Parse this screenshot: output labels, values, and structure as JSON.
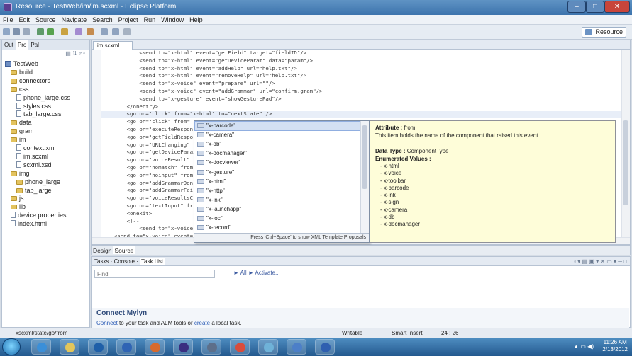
{
  "window": {
    "title": "Resource - TestWeb/im/im.scxml - Eclipse Platform",
    "min": "–",
    "max": "□",
    "close": "✕"
  },
  "menu": [
    "File",
    "Edit",
    "Source",
    "Navigate",
    "Search",
    "Project",
    "Run",
    "Window",
    "Help"
  ],
  "toolbar": {
    "perspective_label": "Resource"
  },
  "left_panel": {
    "tabs": [
      "Out",
      "Pro",
      "Pal"
    ],
    "tools": "▤ ⇅ ▿ ▫",
    "tree": [
      {
        "label": "TestWeb",
        "kind": "project",
        "depth": 0
      },
      {
        "label": "build",
        "kind": "folder",
        "depth": 1
      },
      {
        "label": "connectors",
        "kind": "folder",
        "depth": 1
      },
      {
        "label": "css",
        "kind": "folder",
        "depth": 1
      },
      {
        "label": "phone_large.css",
        "kind": "file",
        "depth": 2
      },
      {
        "label": "styles.css",
        "kind": "file",
        "depth": 2
      },
      {
        "label": "tab_large.css",
        "kind": "file",
        "depth": 2
      },
      {
        "label": "data",
        "kind": "folder",
        "depth": 1
      },
      {
        "label": "gram",
        "kind": "folder",
        "depth": 1
      },
      {
        "label": "im",
        "kind": "folder",
        "depth": 1
      },
      {
        "label": "context.xml",
        "kind": "file",
        "depth": 2
      },
      {
        "label": "im.scxml",
        "kind": "file",
        "depth": 2
      },
      {
        "label": "scxml.xsd",
        "kind": "file",
        "depth": 2
      },
      {
        "label": "img",
        "kind": "folder",
        "depth": 1
      },
      {
        "label": "phone_large",
        "kind": "folder",
        "depth": 2
      },
      {
        "label": "tab_large",
        "kind": "folder",
        "depth": 2
      },
      {
        "label": "js",
        "kind": "folder",
        "depth": 1
      },
      {
        "label": "lib",
        "kind": "folder",
        "depth": 1
      },
      {
        "label": "device.properties",
        "kind": "file",
        "depth": 1
      },
      {
        "label": "index.html",
        "kind": "file",
        "depth": 1
      }
    ]
  },
  "editor": {
    "tab_label": "im.scxml",
    "lines": [
      "            <send to=\"x-html\" event=\"getField\" target=\"fieldID\"/>",
      "            <send to=\"x-html\" event=\"getDeviceParam\" data=\"param\"/>",
      "            <send to=\"x-html\" event=\"addHelp\" url=\"help.txt\"/>",
      "            <send to=\"x-html\" event=\"removeHelp\" url=\"help.txt\"/>",
      "            <send to=\"x-voice\" event=\"prepare\" url=\"\"/>",
      "            <send to=\"x-voice\" event=\"addGrammar\" url=\"confirm.gram\"/>",
      "            <send to=\"x-gesture\" event=\"showGesturePad\"/>",
      "        </onentry>",
      "        <go on=\"click\" from=\"x-html\" to=\"nextState\" />",
      "        <go on=\"click\" from=",
      "        <go on=\"executeRespon",
      "        <go on=\"getFieldRespo",
      "        <go on=\"URLChanging\"",
      "        <go on=\"getDeviceParai",
      "        <go on=\"voiceResult\"",
      "        <go on=\"nomatch\" from",
      "        <go on=\"noinput\" from",
      "        <go on=\"addGrammarDon",
      "        <go on=\"addGrammarFai",
      "        <go on=\"voiceResultsC",
      "        <go on=\"textInput\" fr",
      "        <onexit>",
      "        <!--",
      "            <send to=\"x-voice\" ev",
      "    <send to=\"x-voice\" event="
    ]
  },
  "autocomplete": {
    "items": [
      "\"x-barcode\"",
      "\"x-camera\"",
      "\"x-db\"",
      "\"x-docmanager\"",
      "\"x-docviewer\"",
      "\"x-gesture\"",
      "\"x-html\"",
      "\"x-http\"",
      "\"x-ink\"",
      "\"x-launchapp\"",
      "\"x-loc\"",
      "\"x-record\""
    ],
    "hint": "Press 'Ctrl+Space' to show XML Template Proposals"
  },
  "doc": {
    "attribute_label": "Attribute :",
    "attribute_value": "from",
    "description": "This item holds the name of the component that raised this event.",
    "datatype_label": "Data Type :",
    "datatype_value": "ComponentType",
    "enum_label": "Enumerated Values :",
    "enum_values": [
      "- x-html",
      "- x-voice",
      "- x-toolbar",
      "- x-barcode",
      "- x-ink",
      "- x-sign",
      "- x-camera",
      "- x-db",
      "- x-docmanager"
    ]
  },
  "source_tabs": [
    "Design",
    "Source"
  ],
  "tasks_panel": {
    "tabs": [
      "Tasks",
      "Console",
      "Task List"
    ],
    "find_placeholder": "Find",
    "filter_all": "► All",
    "filter_activate": "► Activate...",
    "mylyn_title": "Connect Mylyn",
    "mylyn_connect": "Connect",
    "mylyn_middle": " to your task and ALM tools or ",
    "mylyn_create": "create",
    "mylyn_end": " a local task."
  },
  "statusbar": {
    "path": "xscxml/state/go/from",
    "mode": "Writable",
    "insert": "Smart Insert",
    "pos": "24 : 26"
  },
  "taskbar": {
    "time": "11:26 AM",
    "date": "2/13/2012"
  }
}
